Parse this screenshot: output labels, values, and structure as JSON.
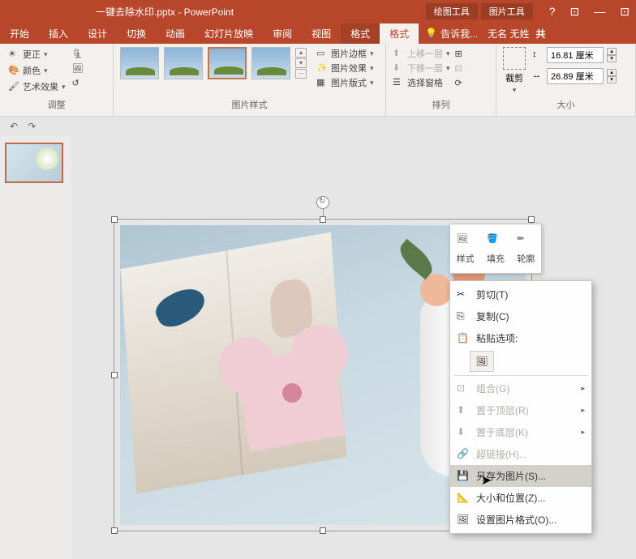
{
  "app": {
    "title": "一键去除水印.pptx - PowerPoint"
  },
  "title_context": {
    "drawing": "绘图工具",
    "picture": "图片工具"
  },
  "winbtns": {
    "help": "?",
    "opts": "⊡",
    "min": "—",
    "restore": "⊡"
  },
  "tabs": {
    "start": "开始",
    "insert": "插入",
    "design": "设计",
    "transition": "切换",
    "animation": "动画",
    "slideshow": "幻灯片放映",
    "review": "审阅",
    "view": "视图",
    "format1": "格式",
    "format2": "格式",
    "tellme": "告诉我...",
    "user": "无名 无姓",
    "share": "共"
  },
  "ribbon": {
    "adjust": {
      "label": "调整",
      "correct": "更正",
      "color": "颜色",
      "artistic": "艺术效果"
    },
    "styles": {
      "label": "图片样式",
      "border": "图片边框",
      "effects": "图片效果",
      "layout": "图片版式"
    },
    "arrange": {
      "label": "排列",
      "bring": "上移一层",
      "send": "下移一层",
      "pane": "选择窗格"
    },
    "size": {
      "label": "大小",
      "crop": "裁剪",
      "height": "16.81 厘米",
      "width": "26.89 厘米"
    }
  },
  "qat": {
    "undo": "↶",
    "redo": "↷"
  },
  "mini": {
    "style": "样式",
    "fill": "填充",
    "outline": "轮廓"
  },
  "ctx": {
    "cut": "剪切(T)",
    "copy": "复制(C)",
    "paste_label": "粘贴选项:",
    "group": "组合(G)",
    "bring": "置于顶层(R)",
    "send": "置于底层(K)",
    "link": "超链接(H)...",
    "save_pic": "另存为图片(S)...",
    "size_pos": "大小和位置(Z)...",
    "format": "设置图片格式(O)..."
  }
}
